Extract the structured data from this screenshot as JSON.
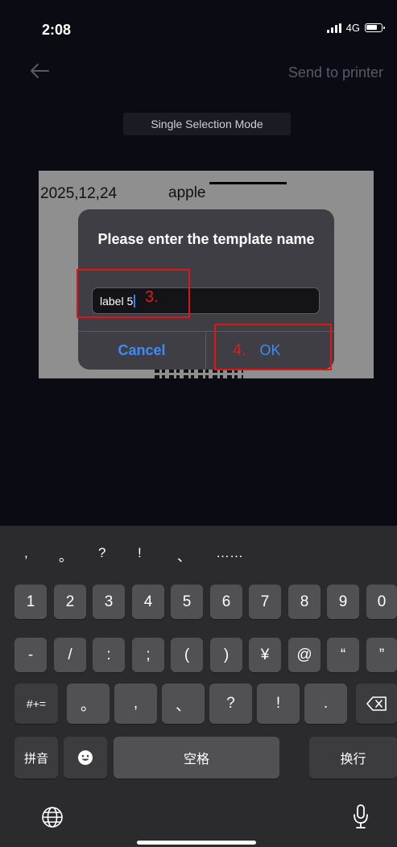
{
  "status": {
    "time": "2:08",
    "network": "4G"
  },
  "nav": {
    "back_icon": "arrow-left-icon",
    "send_label": "Send to printer"
  },
  "mode_label": "Single Selection Mode",
  "canvas": {
    "date": "2025,12,24",
    "word": "apple"
  },
  "dialog": {
    "title": "Please enter the template name",
    "input_value": "label 5",
    "cancel_label": "Cancel",
    "ok_label": "OK"
  },
  "annotations": {
    "step3": "3.",
    "step4": "4."
  },
  "keyboard": {
    "candidates": [
      ",",
      "。",
      "?",
      "!",
      "、",
      "……"
    ],
    "row_numbers": [
      "1",
      "2",
      "3",
      "4",
      "5",
      "6",
      "7",
      "8",
      "9",
      "0"
    ],
    "row_symbols": [
      "-",
      "/",
      ":",
      ";",
      "(",
      ")",
      "¥",
      "@",
      "“",
      "”"
    ],
    "row_third": [
      "#+=",
      "。",
      ",",
      "、",
      "?",
      "!",
      "."
    ],
    "pinyin_label": "拼音",
    "space_label": "空格",
    "return_label": "换行",
    "emoji_icon": "emoji-icon",
    "globe_icon": "globe-icon",
    "mic_icon": "microphone-icon",
    "backspace_icon": "backspace-icon"
  }
}
